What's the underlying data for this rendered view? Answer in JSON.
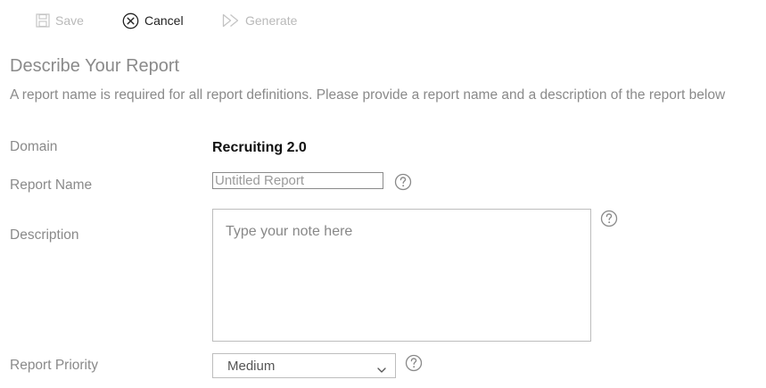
{
  "toolbar": {
    "save_label": "Save",
    "cancel_label": "Cancel",
    "generate_label": "Generate"
  },
  "page": {
    "title": "Describe Your Report",
    "subtitle": "A report name is required for all report definitions. Please provide a report name and a description of the report below"
  },
  "form": {
    "domain_label": "Domain",
    "domain_value": "Recruiting 2.0",
    "report_name_label": "Report Name",
    "report_name_placeholder": "Untitled Report",
    "report_name_value": "",
    "description_label": "Description",
    "description_placeholder": "Type your note here",
    "report_priority_label": "Report Priority",
    "report_priority_value": "Medium"
  },
  "icons": {
    "save": "save-icon",
    "cancel": "circle-x-icon",
    "generate": "double-play-icon",
    "help": "question-circle-icon",
    "dropdown": "chevron-down-icon"
  },
  "colors": {
    "disabled_text": "#b9b9b9",
    "label_text": "#8a8a8a",
    "value_text": "#111111"
  }
}
